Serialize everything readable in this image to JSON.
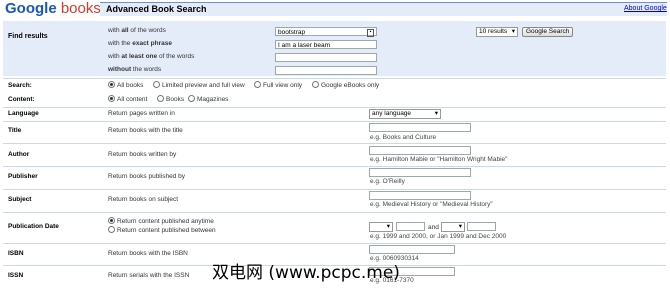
{
  "header": {
    "logo_main": "Google",
    "logo_sub": "books",
    "title": "Advanced Book Search",
    "about_link": "About Google"
  },
  "find": {
    "label": "Find results",
    "rows": [
      {
        "pre": "with ",
        "bold": "all",
        "post": " of the words",
        "value": "bootstrap"
      },
      {
        "pre": "with the ",
        "bold": "exact phrase",
        "post": "",
        "value": "I am a laser beam"
      },
      {
        "pre": "with ",
        "bold": "at least one",
        "post": " of the words",
        "value": ""
      },
      {
        "pre": "",
        "bold": "without",
        "post": " the words",
        "value": ""
      }
    ],
    "results_select": "10 results",
    "search_button": "Google Search"
  },
  "search": {
    "label": "Search:",
    "options": [
      "All books",
      "Limited preview and full view",
      "Full view only",
      "Google eBooks only"
    ],
    "selected": 0
  },
  "content": {
    "label": "Content:",
    "options": [
      "All content",
      "Books",
      "Magazines"
    ],
    "selected": 0
  },
  "language": {
    "label": "Language",
    "desc": "Return pages written in",
    "value": "any language"
  },
  "title": {
    "label": "Title",
    "desc": "Return books with the title",
    "hint": "e.g. Books and Culture"
  },
  "author": {
    "label": "Author",
    "desc": "Return books written by",
    "hint": "e.g. Hamilton Mabie or \"Hamilton Wright Mabie\""
  },
  "publisher": {
    "label": "Publisher",
    "desc": "Return books published by",
    "hint": "e.g. O'Reilly"
  },
  "subject": {
    "label": "Subject",
    "desc": "Return books on subject",
    "hint": "e.g. Medieval History or \"Medieval History\""
  },
  "pubdate": {
    "label": "Publication Date",
    "options": [
      "Return content published anytime",
      "Return content published between"
    ],
    "selected": 0,
    "and_text": "and",
    "hint": "e.g. 1999 and 2000, or Jan 1999 and Dec 2000"
  },
  "isbn": {
    "label": "ISBN",
    "desc": "Return books with the ISBN",
    "hint": "e.g. 0060930314"
  },
  "issn": {
    "label": "ISSN",
    "desc": "Return serials with the ISSN",
    "hint": "e.g. 0161-7370"
  },
  "watermark": "双电网 (www.pcpc.me)"
}
